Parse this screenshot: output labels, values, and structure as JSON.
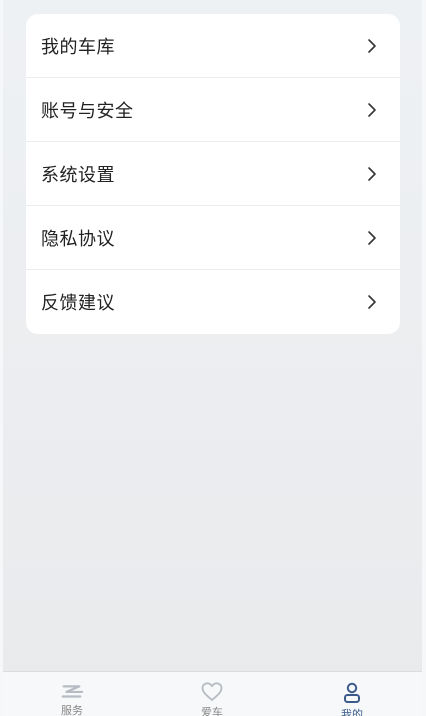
{
  "menu": {
    "items": [
      {
        "label": "我的车库",
        "icon": "chevron-right-icon"
      },
      {
        "label": "账号与安全",
        "icon": "chevron-right-icon"
      },
      {
        "label": "系统设置",
        "icon": "chevron-right-icon"
      },
      {
        "label": "隐私协议",
        "icon": "chevron-right-icon"
      },
      {
        "label": "反馈建议",
        "icon": "chevron-right-icon"
      }
    ]
  },
  "tabbar": {
    "tabs": [
      {
        "label": "服务",
        "icon": "service-icon",
        "active": false
      },
      {
        "label": "爱车",
        "icon": "heart-icon",
        "active": false
      },
      {
        "label": "我的",
        "icon": "person-icon",
        "active": true
      }
    ]
  },
  "colors": {
    "accent": "#3b5a8c",
    "inactive": "#b7bcc4",
    "background": "#eceef1",
    "card": "#ffffff"
  }
}
